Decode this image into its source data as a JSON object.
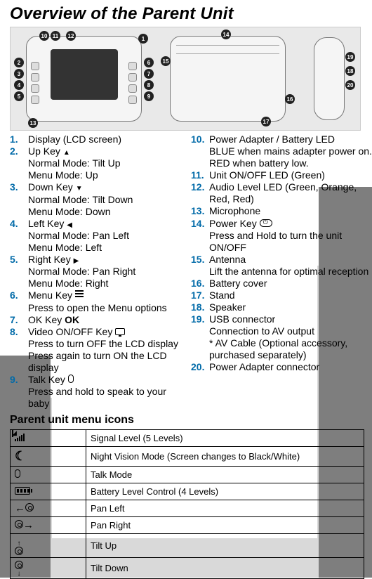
{
  "title": "Overview of the Parent Unit",
  "left_items": [
    {
      "num": "1.",
      "label": "Display (LCD screen)",
      "extras": []
    },
    {
      "num": "2.",
      "label": "Up Key ",
      "icon": "arrow-up",
      "extras": [
        "Normal Mode: Tilt Up",
        "Menu Mode: Up"
      ]
    },
    {
      "num": "3.",
      "label": "Down Key ",
      "icon": "arrow-down",
      "extras": [
        "Normal Mode: Tilt Down",
        "Menu Mode: Down"
      ]
    },
    {
      "num": "4.",
      "label": "Left Key ",
      "icon": "arrow-left",
      "extras": [
        "Normal Mode: Pan Left",
        "Menu Mode: Left"
      ]
    },
    {
      "num": "5.",
      "label": "Right Key ",
      "icon": "arrow-right",
      "extras": [
        "Normal Mode: Pan Right",
        "Menu Mode: Right"
      ]
    },
    {
      "num": "6.",
      "label": "Menu Key ",
      "icon": "menu",
      "extras": [
        "Press to open the Menu options"
      ]
    },
    {
      "num": "7.",
      "label": "OK Key ",
      "icon": "ok",
      "icon_text": "OK",
      "extras": []
    },
    {
      "num": "8.",
      "label": "Video ON/OFF Key ",
      "icon": "screen",
      "extras": [
        "Press to turn OFF the LCD display",
        "Press again to turn ON the LCD display"
      ]
    },
    {
      "num": "9.",
      "label": "Talk Key ",
      "icon": "mic",
      "extras": [
        "Press and hold to speak to your baby"
      ]
    }
  ],
  "right_items": [
    {
      "num": "10.",
      "label": "Power Adapter / Battery LED",
      "extras": [
        "BLUE when mains adapter power on.",
        "RED when battery low."
      ]
    },
    {
      "num": "11.",
      "label": "Unit ON/OFF LED (Green)",
      "extras": []
    },
    {
      "num": "12.",
      "label": "Audio Level LED (Green, Orange, Red, Red)",
      "extras": []
    },
    {
      "num": "13.",
      "label": "Microphone",
      "extras": []
    },
    {
      "num": "14.",
      "label": "Power Key ",
      "icon": "power",
      "extras": [
        "Press and Hold to turn the unit ON/OFF"
      ]
    },
    {
      "num": "15.",
      "label": "Antenna",
      "extras": [
        "Lift the antenna for optimal reception"
      ]
    },
    {
      "num": "16.",
      "label": "Battery cover",
      "extras": []
    },
    {
      "num": "17.",
      "label": "Stand",
      "extras": []
    },
    {
      "num": "18.",
      "label": "Speaker",
      "extras": []
    },
    {
      "num": "19.",
      "label": "USB connector",
      "extras": [
        "Connection to AV output",
        "* AV Cable (Optional accessory, purchased separately)"
      ]
    },
    {
      "num": "20.",
      "label": "Power Adapter connector",
      "extras": []
    }
  ],
  "section2_title": "Parent unit menu icons",
  "icon_rows": [
    {
      "icon": "signal",
      "desc": "Signal Level (5 Levels)"
    },
    {
      "icon": "moon",
      "desc": "Night Vision Mode (Screen changes to Black/White)"
    },
    {
      "icon": "mic",
      "desc": "Talk Mode"
    },
    {
      "icon": "battery",
      "desc": "Battery Level Control (4 Levels)"
    },
    {
      "icon": "pan-left",
      "desc": "Pan Left"
    },
    {
      "icon": "pan-right",
      "desc": "Pan Right"
    },
    {
      "icon": "tilt-up",
      "desc": "Tilt Up"
    },
    {
      "icon": "tilt-down",
      "desc": "Tilt Down"
    }
  ]
}
